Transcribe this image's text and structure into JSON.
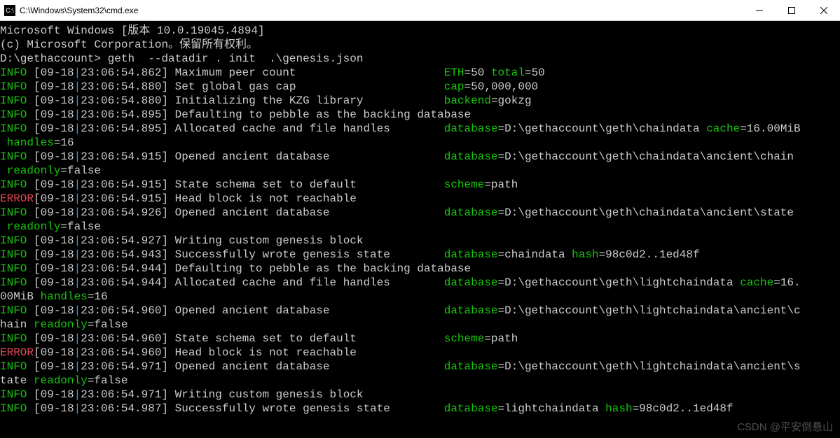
{
  "window": {
    "title": "C:\\Windows\\System32\\cmd.exe",
    "icon_label": "C:\\"
  },
  "header": {
    "line1": "Microsoft Windows [版本 10.0.19045.4894]",
    "line2": "(c) Microsoft Corporation。保留所有权利。"
  },
  "prompt": {
    "path": "D:\\gethaccount>",
    "command": " geth  --datadir . init  .\\genesis.json"
  },
  "logs": [
    {
      "level": "INFO ",
      "date": "09-18",
      "time": "23:06:54.862",
      "msg": "Maximum peer count                      ",
      "kv": [
        [
          "ETH",
          "50"
        ],
        [
          "total",
          "50"
        ]
      ]
    },
    {
      "level": "INFO ",
      "date": "09-18",
      "time": "23:06:54.880",
      "msg": "Set global gas cap                      ",
      "kv": [
        [
          "cap",
          "50,000,000"
        ]
      ]
    },
    {
      "level": "INFO ",
      "date": "09-18",
      "time": "23:06:54.880",
      "msg": "Initializing the KZG library            ",
      "kv": [
        [
          "backend",
          "gokzg"
        ]
      ]
    },
    {
      "level": "INFO ",
      "date": "09-18",
      "time": "23:06:54.895",
      "msg": "Defaulting to pebble as the backing database",
      "kv": []
    },
    {
      "level": "INFO ",
      "date": "09-18",
      "time": "23:06:54.895",
      "msg": "Allocated cache and file handles        ",
      "kv": [
        [
          "database",
          "D:\\gethaccount\\geth\\chaindata"
        ],
        [
          "cache",
          "16.00MiB"
        ]
      ],
      "wrap_kv": [
        [
          "handles",
          "16"
        ]
      ]
    },
    {
      "level": "INFO ",
      "date": "09-18",
      "time": "23:06:54.915",
      "msg": "Opened ancient database                 ",
      "kv": [
        [
          "database",
          "D:\\gethaccount\\geth\\chaindata\\ancient\\chain"
        ]
      ],
      "wrap_kv": [
        [
          "readonly",
          "false"
        ]
      ]
    },
    {
      "level": "INFO ",
      "date": "09-18",
      "time": "23:06:54.915",
      "msg": "State schema set to default             ",
      "kv": [
        [
          "scheme",
          "path"
        ]
      ]
    },
    {
      "level": "ERROR",
      "date": "09-18",
      "time": "23:06:54.915",
      "msg": "Head block is not reachable",
      "kv": []
    },
    {
      "level": "INFO ",
      "date": "09-18",
      "time": "23:06:54.926",
      "msg": "Opened ancient database                 ",
      "kv": [
        [
          "database",
          "D:\\gethaccount\\geth\\chaindata\\ancient\\state"
        ]
      ],
      "wrap_kv": [
        [
          "readonly",
          "false"
        ]
      ]
    },
    {
      "level": "INFO ",
      "date": "09-18",
      "time": "23:06:54.927",
      "msg": "Writing custom genesis block",
      "kv": []
    },
    {
      "level": "INFO ",
      "date": "09-18",
      "time": "23:06:54.943",
      "msg": "Successfully wrote genesis state        ",
      "kv": [
        [
          "database",
          "chaindata"
        ],
        [
          "hash",
          "98c0d2..1ed48f"
        ]
      ]
    },
    {
      "level": "INFO ",
      "date": "09-18",
      "time": "23:06:54.944",
      "msg": "Defaulting to pebble as the backing database",
      "kv": []
    },
    {
      "level": "INFO ",
      "date": "09-18",
      "time": "23:06:54.944",
      "msg": "Allocated cache and file handles        ",
      "kv": [
        [
          "database",
          "D:\\gethaccount\\geth\\lightchaindata"
        ],
        [
          "cache",
          "16."
        ]
      ],
      "wrap_raw": "00MiB ",
      "wrap_kv": [
        [
          "handles",
          "16"
        ]
      ]
    },
    {
      "level": "INFO ",
      "date": "09-18",
      "time": "23:06:54.960",
      "msg": "Opened ancient database                 ",
      "kv": [
        [
          "database",
          "D:\\gethaccount\\geth\\lightchaindata\\ancient\\c"
        ]
      ],
      "wrap_raw": "hain ",
      "wrap_kv": [
        [
          "readonly",
          "false"
        ]
      ]
    },
    {
      "level": "INFO ",
      "date": "09-18",
      "time": "23:06:54.960",
      "msg": "State schema set to default             ",
      "kv": [
        [
          "scheme",
          "path"
        ]
      ]
    },
    {
      "level": "ERROR",
      "date": "09-18",
      "time": "23:06:54.960",
      "msg": "Head block is not reachable",
      "kv": []
    },
    {
      "level": "INFO ",
      "date": "09-18",
      "time": "23:06:54.971",
      "msg": "Opened ancient database                 ",
      "kv": [
        [
          "database",
          "D:\\gethaccount\\geth\\lightchaindata\\ancient\\s"
        ]
      ],
      "wrap_raw": "tate ",
      "wrap_kv": [
        [
          "readonly",
          "false"
        ]
      ]
    },
    {
      "level": "INFO ",
      "date": "09-18",
      "time": "23:06:54.971",
      "msg": "Writing custom genesis block",
      "kv": []
    },
    {
      "level": "INFO ",
      "date": "09-18",
      "time": "23:06:54.987",
      "msg": "Successfully wrote genesis state        ",
      "kv": [
        [
          "database",
          "lightchaindata"
        ],
        [
          "hash",
          "98c0d2..1ed48f"
        ]
      ]
    }
  ],
  "watermark": "CSDN @平安倒悬山"
}
